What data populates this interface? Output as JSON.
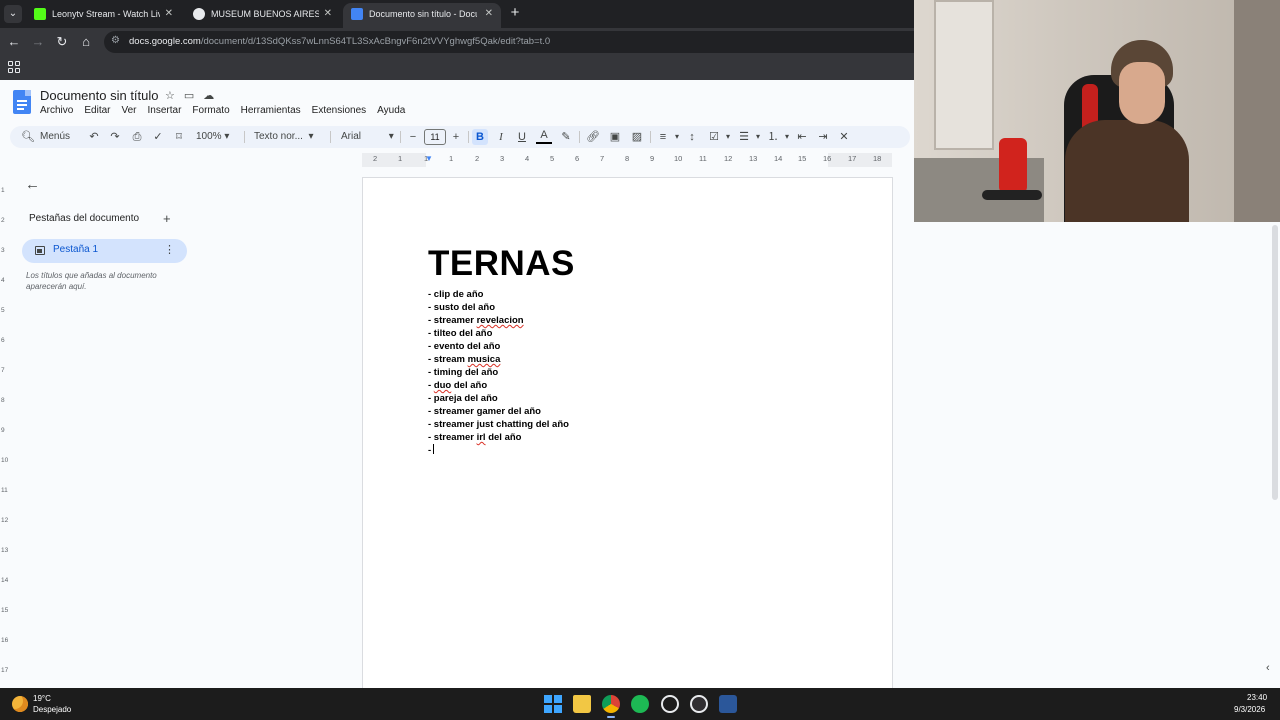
{
  "browser": {
    "tabs": [
      {
        "title": "Leonytv Stream - Watch Live on",
        "favicon_color": "#53fc18"
      },
      {
        "title": "MUSEUM BUENOS AIRES VACIO",
        "favicon_color": "#e8eaed"
      },
      {
        "title": "Documento sin título - Docum",
        "favicon_color": "#4285f4"
      }
    ],
    "active_tab": 2,
    "url_domain": "docs.google.com",
    "url_path": "/document/d/13SdQKss7wLnnS64TL3SxAcBngvF6n2tVVYghwgf5Qak/edit?tab=t.0"
  },
  "docs": {
    "title": "Documento sin título",
    "menu": [
      "Archivo",
      "Editar",
      "Ver",
      "Insertar",
      "Formato",
      "Herramientas",
      "Extensiones",
      "Ayuda"
    ],
    "toolbar": {
      "menus_label": "Menús",
      "zoom": "100%",
      "style": "Texto nor...",
      "font": "Arial",
      "font_size": "11"
    },
    "ruler_labels": [
      "2",
      "1",
      "1",
      "1",
      "2",
      "3",
      "4",
      "5",
      "6",
      "7",
      "8",
      "9",
      "10",
      "11",
      "12",
      "13",
      "14",
      "15",
      "16",
      "17",
      "18"
    ],
    "vruler_labels": [
      "1",
      "2",
      "3",
      "4",
      "5",
      "6",
      "7",
      "8",
      "9",
      "10",
      "11",
      "12",
      "13",
      "14",
      "15",
      "16",
      "17"
    ]
  },
  "sidebar": {
    "title": "Pestañas del documento",
    "tab_label": "Pestaña 1",
    "hint": "Los títulos que añadas al documento aparecerán aquí."
  },
  "document": {
    "heading": "TERNAS",
    "items": [
      {
        "prefix": "- clip de año",
        "sq": "",
        "suffix": ""
      },
      {
        "prefix": "- susto del año",
        "sq": "",
        "suffix": ""
      },
      {
        "prefix": "- streamer ",
        "sq": "revelacion",
        "suffix": ""
      },
      {
        "prefix": "- tilteo del año",
        "sq": "",
        "suffix": ""
      },
      {
        "prefix": "- evento del año",
        "sq": "",
        "suffix": ""
      },
      {
        "prefix": "- stream ",
        "sq": "musica",
        "suffix": ""
      },
      {
        "prefix": "- timing del año",
        "sq": "",
        "suffix": ""
      },
      {
        "prefix": "- ",
        "sq": "duo",
        "suffix": " del año"
      },
      {
        "prefix": "- pareja del año",
        "sq": "",
        "suffix": ""
      },
      {
        "prefix": "- streamer gamer del año",
        "sq": "",
        "suffix": ""
      },
      {
        "prefix": "- streamer just chatting del año",
        "sq": "",
        "suffix": ""
      },
      {
        "prefix": "- streamer ",
        "sq": "irl",
        "suffix": " del año"
      },
      {
        "prefix": "-",
        "sq": "",
        "suffix": ""
      }
    ]
  },
  "taskbar": {
    "weather_temp": "19°C",
    "weather_desc": "Despejado",
    "time": "23:40",
    "date": "9/3/2026",
    "apps": [
      "windows-start",
      "file-explorer",
      "chrome",
      "spotify",
      "steam",
      "obs",
      "word"
    ]
  }
}
